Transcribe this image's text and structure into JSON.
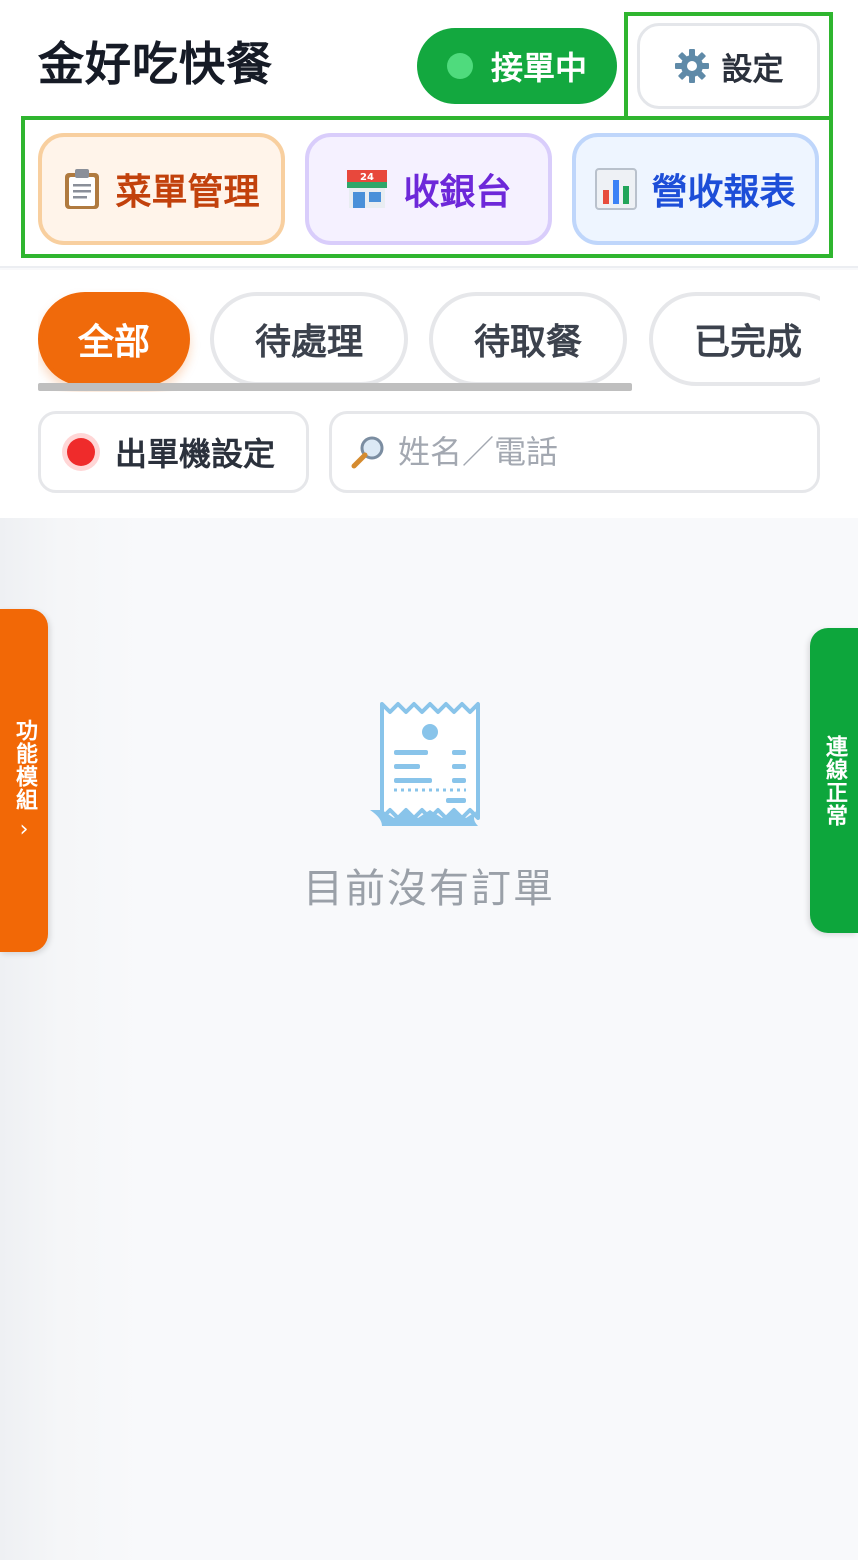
{
  "header": {
    "title": "金好吃快餐",
    "status_label": "接單中",
    "settings_label": "設定"
  },
  "modules": [
    {
      "label": "菜單管理",
      "icon": "clipboard-icon"
    },
    {
      "label": "收銀台",
      "icon": "store-24-icon"
    },
    {
      "label": "營收報表",
      "icon": "bar-chart-icon"
    }
  ],
  "tabs": [
    {
      "label": "全部",
      "active": true
    },
    {
      "label": "待處理",
      "active": false
    },
    {
      "label": "待取餐",
      "active": false
    },
    {
      "label": "已完成",
      "active": false
    }
  ],
  "printer": {
    "label": "出單機設定",
    "status_color": "#ef2b2b"
  },
  "search": {
    "placeholder": "姓名／電話"
  },
  "empty_state": {
    "message": "目前沒有訂單",
    "icon": "receipt-icon"
  },
  "side_left": {
    "label": "功能模組",
    "chevron": "›"
  },
  "side_right": {
    "label": "連線正常"
  },
  "colors": {
    "status_green": "#13a83f",
    "accent_orange": "#f06a0b",
    "highlight_green": "#2fb52f"
  }
}
